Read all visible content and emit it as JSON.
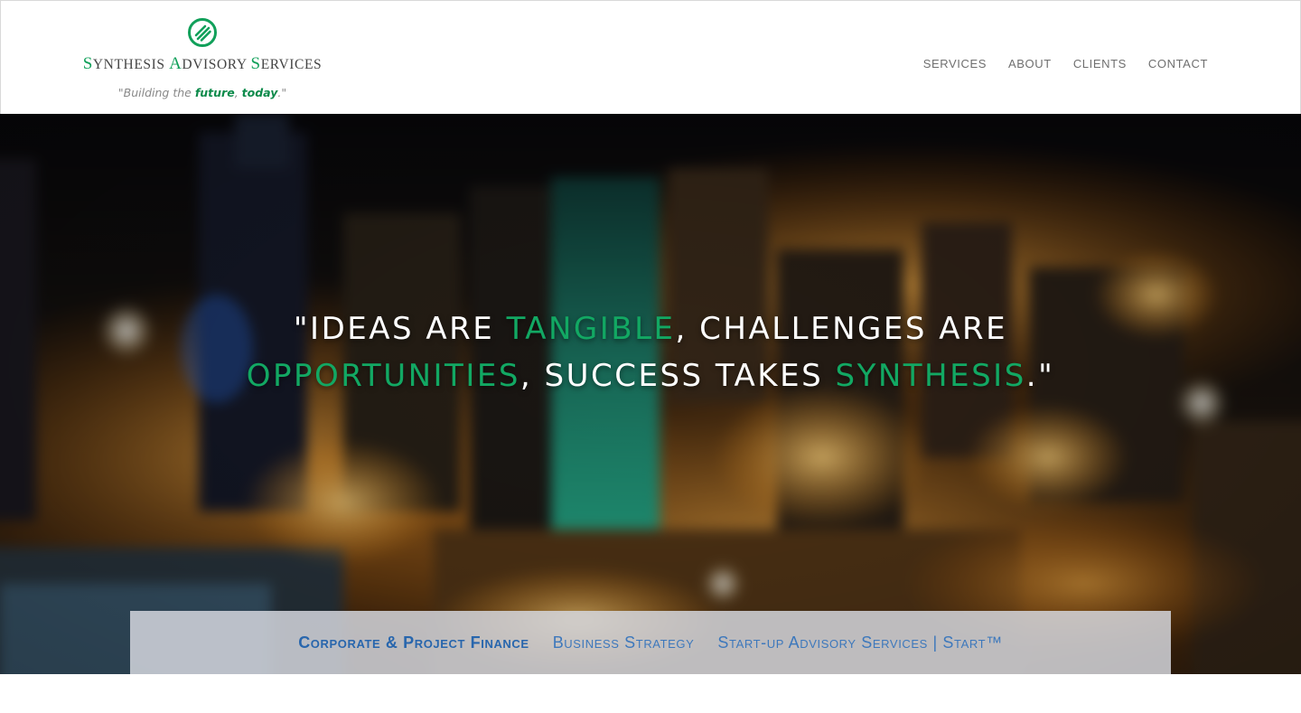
{
  "brand": {
    "name_parts": [
      {
        "cap": "S",
        "rest": "YNTHESIS "
      },
      {
        "cap": "A",
        "rest": "DVISORY "
      },
      {
        "cap": "S",
        "rest": "ERVICES"
      }
    ],
    "tagline_prefix": "\"Building the ",
    "tagline_future": "future",
    "tagline_sep": ", ",
    "tagline_today": "today",
    "tagline_suffix": ".\"",
    "accent_color": "#11a05a"
  },
  "nav": {
    "items": [
      {
        "label": "SERVICES"
      },
      {
        "label": "ABOUT"
      },
      {
        "label": "CLIENTS"
      },
      {
        "label": "CONTACT"
      }
    ]
  },
  "hero": {
    "quote_open": "\"Ideas are ",
    "quote_w1": "tangible",
    "quote_mid1": ", challenges are ",
    "quote_w2": "opportunities",
    "quote_mid2": ", success takes ",
    "quote_w3": "synthesis",
    "quote_close": ".\""
  },
  "services": {
    "links": [
      {
        "label": "Corporate & Project Finance",
        "active": true
      },
      {
        "label": "Business Strategy",
        "active": false
      },
      {
        "label": "Start-up Advisory Services | Start™",
        "active": false
      }
    ]
  }
}
